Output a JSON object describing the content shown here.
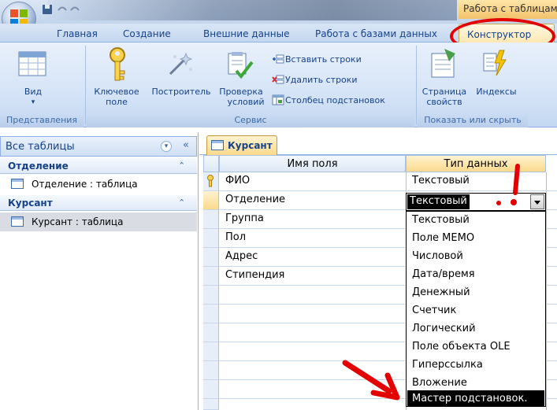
{
  "title_bar": {
    "context_label": "Работа с таблицам"
  },
  "ribbon_tabs": [
    "Главная",
    "Создание",
    "Внешние данные",
    "Работа с базами данных"
  ],
  "active_tab": "Конструктор",
  "ribbon": {
    "view_label": "Вид",
    "key_field_label": [
      "Ключевое",
      "поле"
    ],
    "builder_label": "Построитель",
    "validation_label": [
      "Проверка",
      "условий"
    ],
    "insert_rows_label": "Вставить строки",
    "delete_rows_label": "Удалить строки",
    "lookup_column_label": "Столбец подстановок",
    "property_sheet_label": [
      "Страница",
      "свойств"
    ],
    "indexes_label": "Индексы",
    "groups": {
      "views": "Представления",
      "tools": "Сервис",
      "show_hide": "Показать или скрыть"
    }
  },
  "nav": {
    "header": "Все таблицы",
    "groups": [
      {
        "name": "Отделение",
        "items": [
          "Отделение : таблица"
        ]
      },
      {
        "name": "Курсант",
        "items": [
          "Курсант : таблица"
        ]
      }
    ]
  },
  "document": {
    "tab_label": "Курсант",
    "columns": [
      "Имя поля",
      "Тип данных"
    ],
    "rows": [
      {
        "field": "ФИО",
        "type": "Текстовый",
        "primary_key": true
      },
      {
        "field": "Отделение",
        "type": "Текстовый",
        "primary_key": false
      },
      {
        "field": "Группа",
        "type": "",
        "primary_key": false
      },
      {
        "field": "Пол",
        "type": "",
        "primary_key": false
      },
      {
        "field": "Адрес",
        "type": "",
        "primary_key": false
      },
      {
        "field": "Стипендия",
        "type": "",
        "primary_key": false
      }
    ]
  },
  "dropdown": {
    "current_value": "Текстовый",
    "options": [
      "Текстовый",
      "Поле МЕМО",
      "Числовой",
      "Дата/время",
      "Денежный",
      "Счетчик",
      "Логический",
      "Поле объекта OLE",
      "Гиперссылка",
      "Вложение",
      "Мастер подстановок."
    ],
    "highlighted_option": "Мастер подстановок."
  },
  "annotation_color": "#e30000"
}
